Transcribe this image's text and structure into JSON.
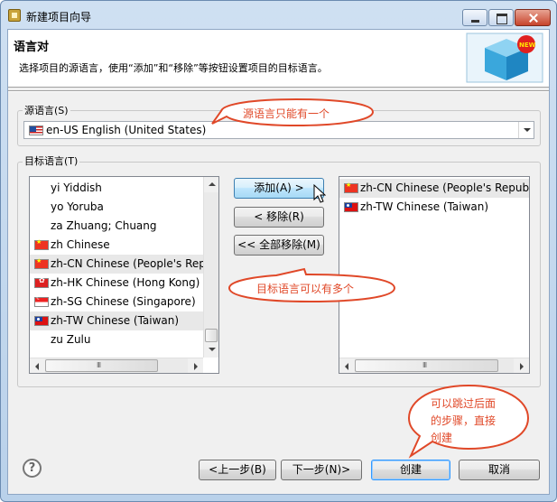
{
  "window": {
    "title": "新建项目向导"
  },
  "header": {
    "title": "语言对",
    "description": "选择项目的源语言，使用“添加”和“移除”等按钮设置项目的目标语言。",
    "banner_badge": "NEW"
  },
  "source": {
    "group_label": "源语言(S)",
    "selected_value": "en-US English (United States)",
    "selected_flag": "us-flag-icon"
  },
  "target": {
    "group_label": "目标语言(T)",
    "available": [
      {
        "flag": "",
        "label": "yi Yiddish",
        "selected": false
      },
      {
        "flag": "",
        "label": "yo Yoruba",
        "selected": false
      },
      {
        "flag": "",
        "label": "za Zhuang; Chuang",
        "selected": false
      },
      {
        "flag": "cn",
        "label": "zh Chinese",
        "selected": false
      },
      {
        "flag": "cn",
        "label": "zh-CN Chinese (People's Rep",
        "selected": true
      },
      {
        "flag": "hk",
        "label": "zh-HK Chinese (Hong Kong)",
        "selected": false
      },
      {
        "flag": "sg",
        "label": "zh-SG Chinese (Singapore)",
        "selected": false
      },
      {
        "flag": "tw",
        "label": "zh-TW Chinese (Taiwan)",
        "selected": true
      },
      {
        "flag": "",
        "label": "zu Zulu",
        "selected": false
      }
    ],
    "chosen": [
      {
        "flag": "cn",
        "label": "zh-CN Chinese (People's Republ",
        "selected": true
      },
      {
        "flag": "tw",
        "label": "zh-TW Chinese (Taiwan)",
        "selected": false
      }
    ],
    "buttons": {
      "add": "添加(A) >",
      "remove": "< 移除(R)",
      "remove_all": "<< 全部移除(M)"
    }
  },
  "scroll_grip": "III",
  "callouts": {
    "source_note": "源语言只能有一个",
    "target_note": "目标语言可以有多个",
    "skip_note_line1": "可以跳过后面",
    "skip_note_line2": "的步骤，直接",
    "skip_note_line3": "创建"
  },
  "footer": {
    "help": "?",
    "back": "<上一步(B)",
    "next": "下一步(N)>",
    "finish": "创建",
    "cancel": "取消"
  },
  "colors": {
    "callout_border": "#e04828",
    "callout_text": "#e04828",
    "selection": "#e8e8e8",
    "hover_button": "#bee6fd"
  }
}
